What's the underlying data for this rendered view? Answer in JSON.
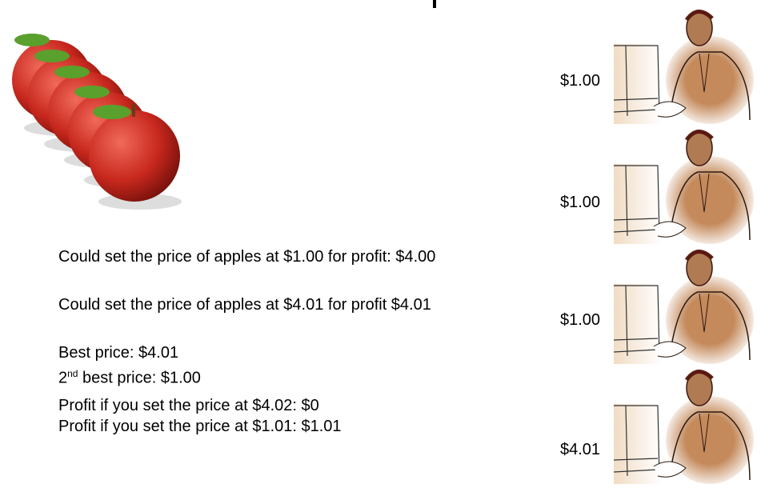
{
  "slide": {
    "lines": {
      "option1": "Could set the price of apples at $1.00 for profit: $4.00",
      "option2": "Could set the price of apples at $4.01 for profit $4.01",
      "best": "Best price:  $4.01",
      "second_prefix": "2",
      "second_sup": "nd",
      "second_rest": " best price:  $1.00",
      "profit402": "Profit if you set the price at $4.02:  $0",
      "profit101": "Profit if you set the price at $1.01: $1.01"
    },
    "bidders": [
      {
        "price": "$1.00",
        "icon": "businessman-at-computer-icon"
      },
      {
        "price": "$1.00",
        "icon": "businessman-at-computer-icon"
      },
      {
        "price": "$1.00",
        "icon": "businessman-at-computer-icon"
      },
      {
        "price": "$4.01",
        "icon": "businessman-at-computer-icon"
      }
    ],
    "apple_count": 5,
    "colors": {
      "apple": "#c8281e",
      "leaf": "#5aa02c",
      "suit": "#c48a5c",
      "monitor": "#f1dcc4"
    }
  }
}
